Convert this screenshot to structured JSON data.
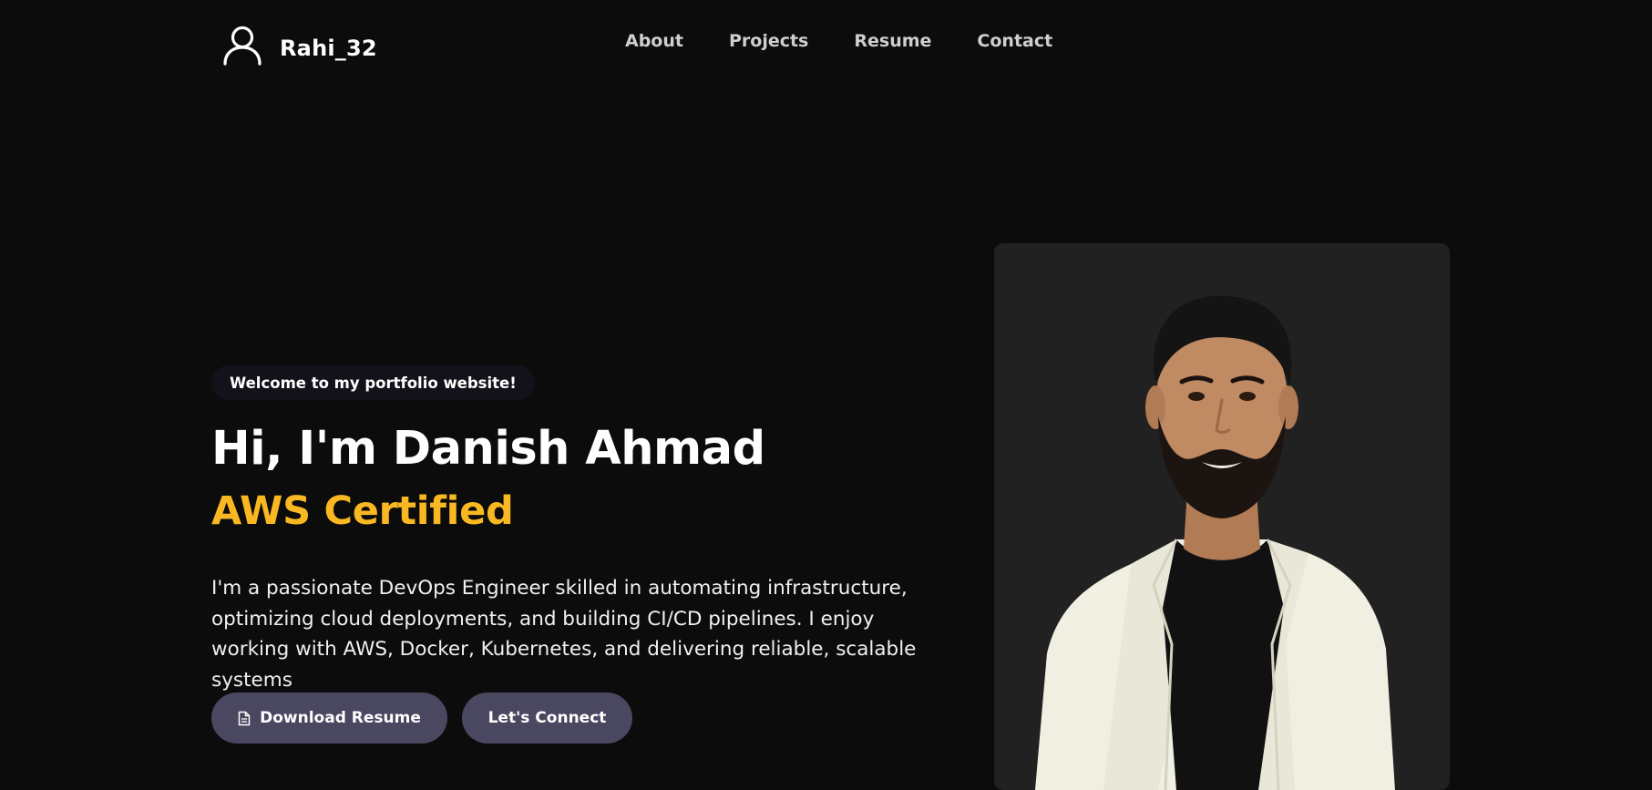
{
  "brand": {
    "name": "Rahi_32",
    "icon": "user-outline-icon"
  },
  "nav": {
    "items": [
      {
        "label": "About"
      },
      {
        "label": "Projects"
      },
      {
        "label": "Resume"
      },
      {
        "label": "Contact"
      }
    ]
  },
  "hero": {
    "badge": "Welcome to my portfolio website!",
    "title": "Hi, I'm Danish Ahmad",
    "subtitle": "AWS Certified",
    "description": "I'm a passionate DevOps Engineer skilled in automating infrastructure, optimizing cloud deployments, and building CI/CD pipelines. I enjoy working with AWS, Docker, Kubernetes, and delivering reliable, scalable systems"
  },
  "buttons": {
    "download_label": "Download Resume",
    "download_icon": "document-icon",
    "connect_label": "Let's Connect"
  },
  "colors": {
    "background": "#0c0c0c",
    "accent": "#f9b821",
    "button": "#4a4760",
    "photo_card": "#212121"
  }
}
